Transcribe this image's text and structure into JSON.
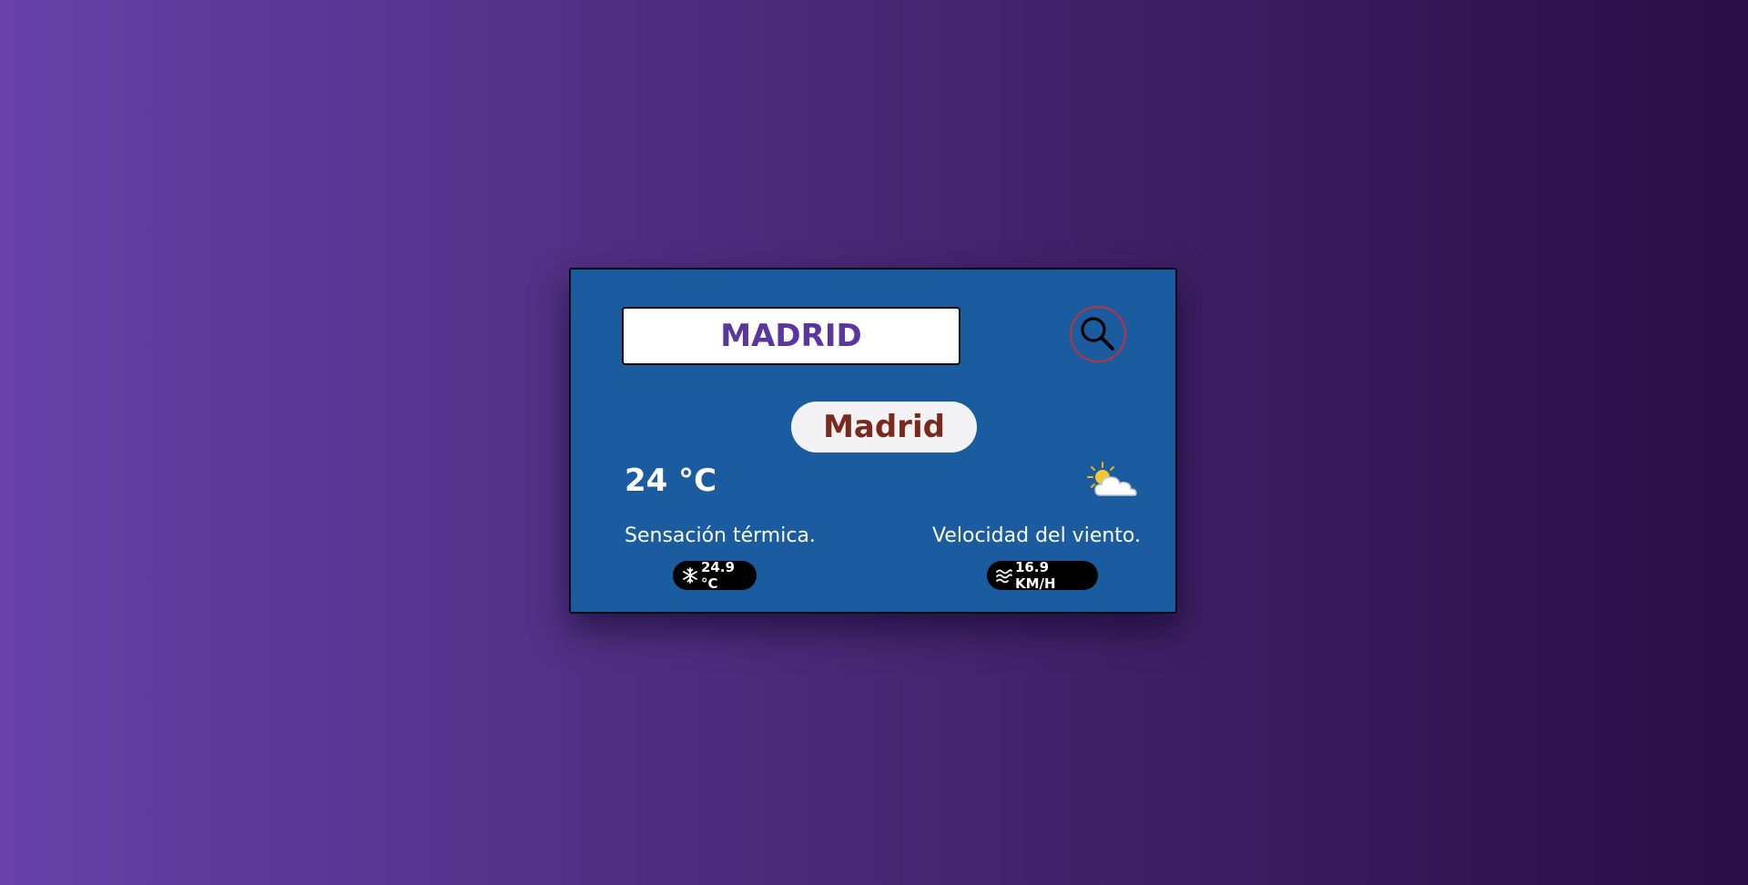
{
  "search": {
    "value": "MADRID"
  },
  "weather": {
    "city": "Madrid",
    "temperature": "24 °C",
    "feels_like_label": "Sensación térmica.",
    "feels_like_value": "24.9 °C",
    "wind_label": "Velocidad del viento.",
    "wind_value": "16.9 KM/H",
    "condition_icon": "partly-cloudy-icon"
  },
  "colors": {
    "card_background": "#1a5c9f",
    "search_text": "#5b36a0",
    "city_text": "#7a2a1c",
    "search_button_border": "#c0323a",
    "badge_background": "#000000"
  }
}
